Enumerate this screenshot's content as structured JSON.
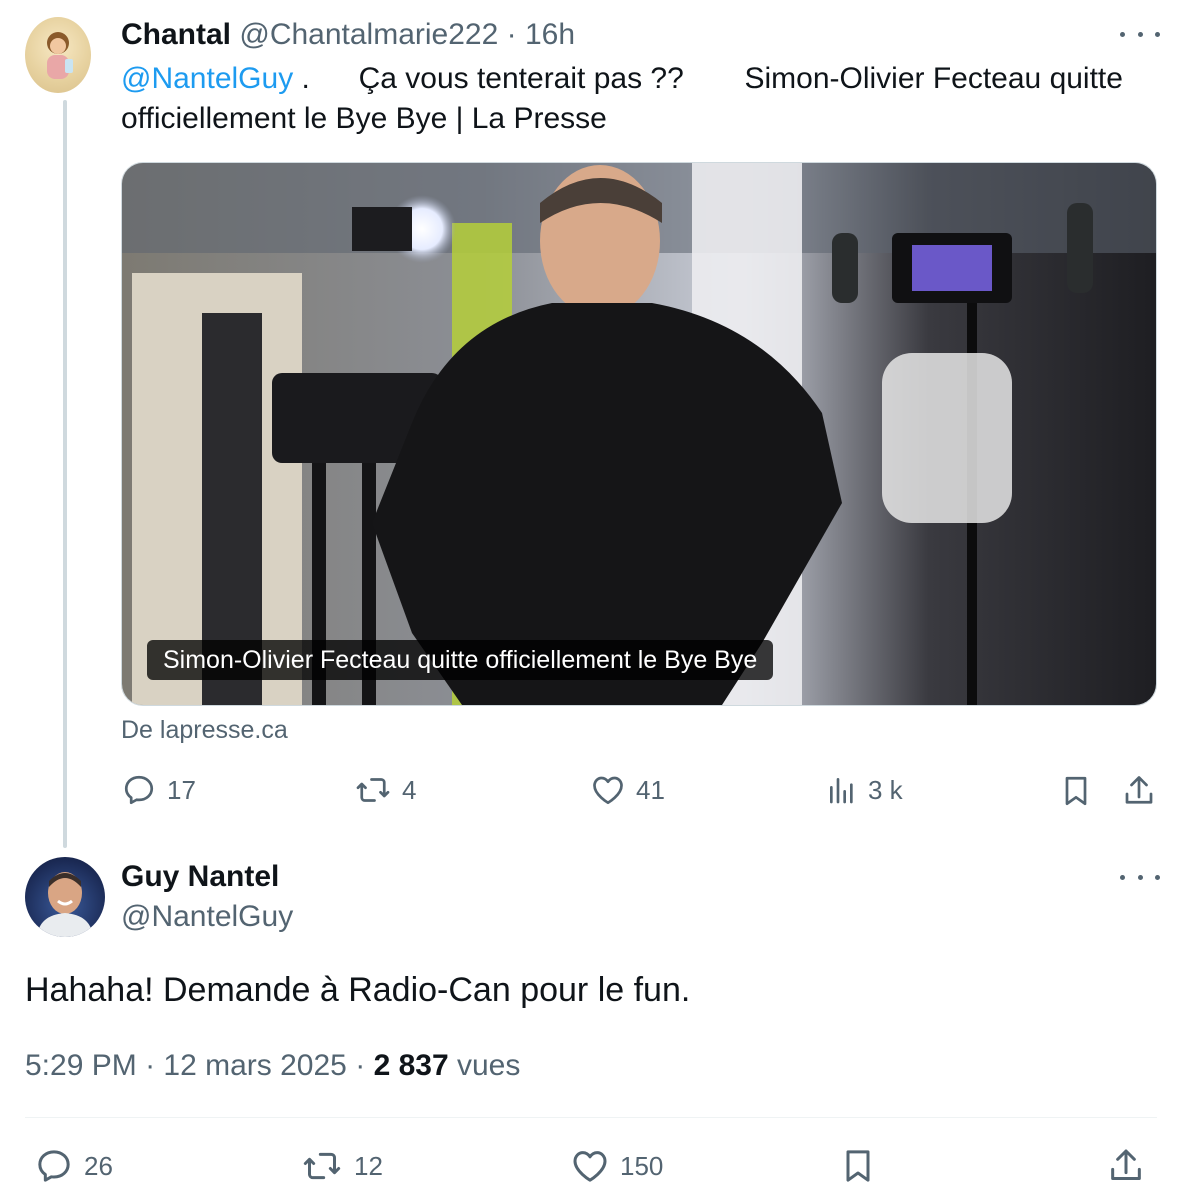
{
  "tweet1": {
    "display_name": "Chantal",
    "handle": "@Chantalmarie222",
    "separator": "·",
    "time_ago": "16h",
    "mention": "@NantelGuy",
    "text_part1": ".",
    "text_part2": "Ça vous tenterait pas ??",
    "text_part3": "Simon-Olivier Fecteau quitte officiellement le Bye Bye | La Presse",
    "card_caption": "Simon-Olivier Fecteau quitte officiellement le Bye Bye",
    "card_source": "De lapresse.ca",
    "actions": {
      "replies": "17",
      "reposts": "4",
      "likes": "41",
      "views": "3 k"
    }
  },
  "tweet2": {
    "display_name": "Guy Nantel",
    "handle": "@NantelGuy",
    "text": "Hahaha! Demande à Radio-Can pour le fun.",
    "time": "5:29 PM",
    "separator": "·",
    "date": "12 mars 2025",
    "view_count": "2 837",
    "views_label": "vues",
    "actions": {
      "replies": "26",
      "reposts": "12",
      "likes": "150"
    }
  },
  "icons": [
    "more-icon",
    "reply-icon",
    "repost-icon",
    "like-icon",
    "views-icon",
    "bookmark-icon",
    "share-icon"
  ],
  "colors": {
    "link": "#1d9bf0",
    "muted": "#536471",
    "text": "#0f1419",
    "border": "#cfd9de"
  }
}
